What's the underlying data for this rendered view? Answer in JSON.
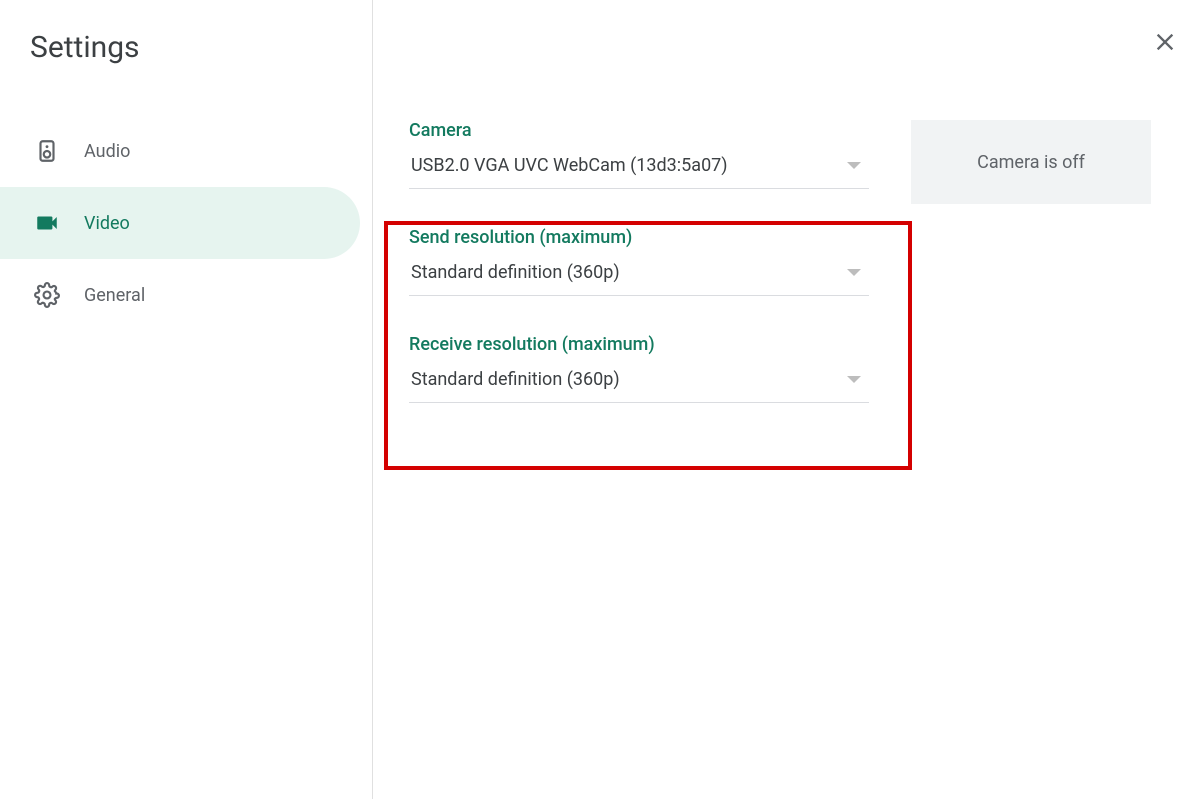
{
  "title": "Settings",
  "sidebar": {
    "items": [
      {
        "id": "audio",
        "label": "Audio"
      },
      {
        "id": "video",
        "label": "Video"
      },
      {
        "id": "general",
        "label": "General"
      }
    ],
    "active": "video"
  },
  "content": {
    "camera": {
      "label": "Camera",
      "value": "USB2.0 VGA UVC WebCam (13d3:5a07)"
    },
    "send_resolution": {
      "label": "Send resolution (maximum)",
      "value": "Standard definition (360p)"
    },
    "receive_resolution": {
      "label": "Receive resolution (maximum)",
      "value": "Standard definition (360p)"
    },
    "preview_status": "Camera is off"
  },
  "annotation": {
    "highlight": "send-and-receive-resolution"
  }
}
